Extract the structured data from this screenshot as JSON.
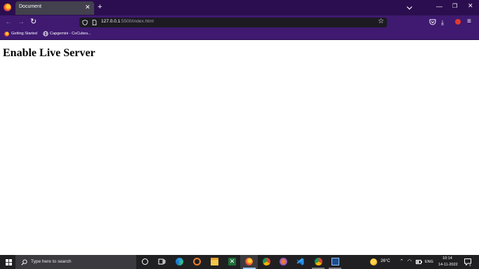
{
  "browser": {
    "tab": {
      "title": "Document"
    },
    "url": {
      "host": "127.0.0.1",
      "path": ":5500/index.html"
    },
    "bookmarks": [
      {
        "label": "Getting Started"
      },
      {
        "label": "Capgemini - CoCubes..."
      }
    ]
  },
  "page": {
    "heading": "Enable Live Server"
  },
  "taskbar": {
    "search_placeholder": "Type here to search",
    "weather": "26°C",
    "language": "ENG",
    "time": "10:14",
    "date": "14-11-2022",
    "notification_count": "1"
  },
  "colors": {
    "titlebar": "#2b0e4f",
    "toolbar": "#3f1a70",
    "urlbar": "#1c1b22",
    "taskbar": "#202023"
  }
}
